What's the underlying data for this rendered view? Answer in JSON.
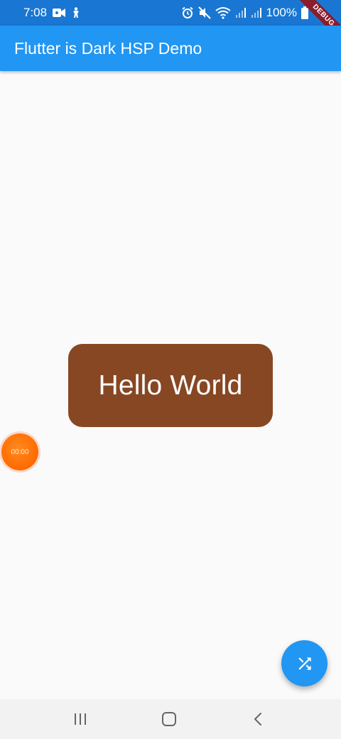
{
  "status_bar": {
    "time": "7:08",
    "battery": "100%",
    "icons": [
      "video-camera-icon",
      "accessibility-icon",
      "alarm-icon",
      "mute-icon",
      "wifi-icon",
      "signal-icon",
      "signal-icon",
      "battery-icon"
    ]
  },
  "debug_banner": "DEBUG",
  "app_bar": {
    "title": "Flutter is Dark HSP Demo"
  },
  "main": {
    "greeting": "Hello World",
    "card_color": "#874723"
  },
  "timer_bubble": {
    "time": "00:00",
    "color": "#ff6a00"
  },
  "fab": {
    "icon": "shuffle-icon",
    "color": "#2196f3"
  },
  "nav_bar": {
    "buttons": [
      "recent-apps-icon",
      "home-icon",
      "back-icon"
    ]
  },
  "colors": {
    "status_bar": "#1976d2",
    "app_bar": "#2196f3",
    "background": "#fafafa"
  }
}
